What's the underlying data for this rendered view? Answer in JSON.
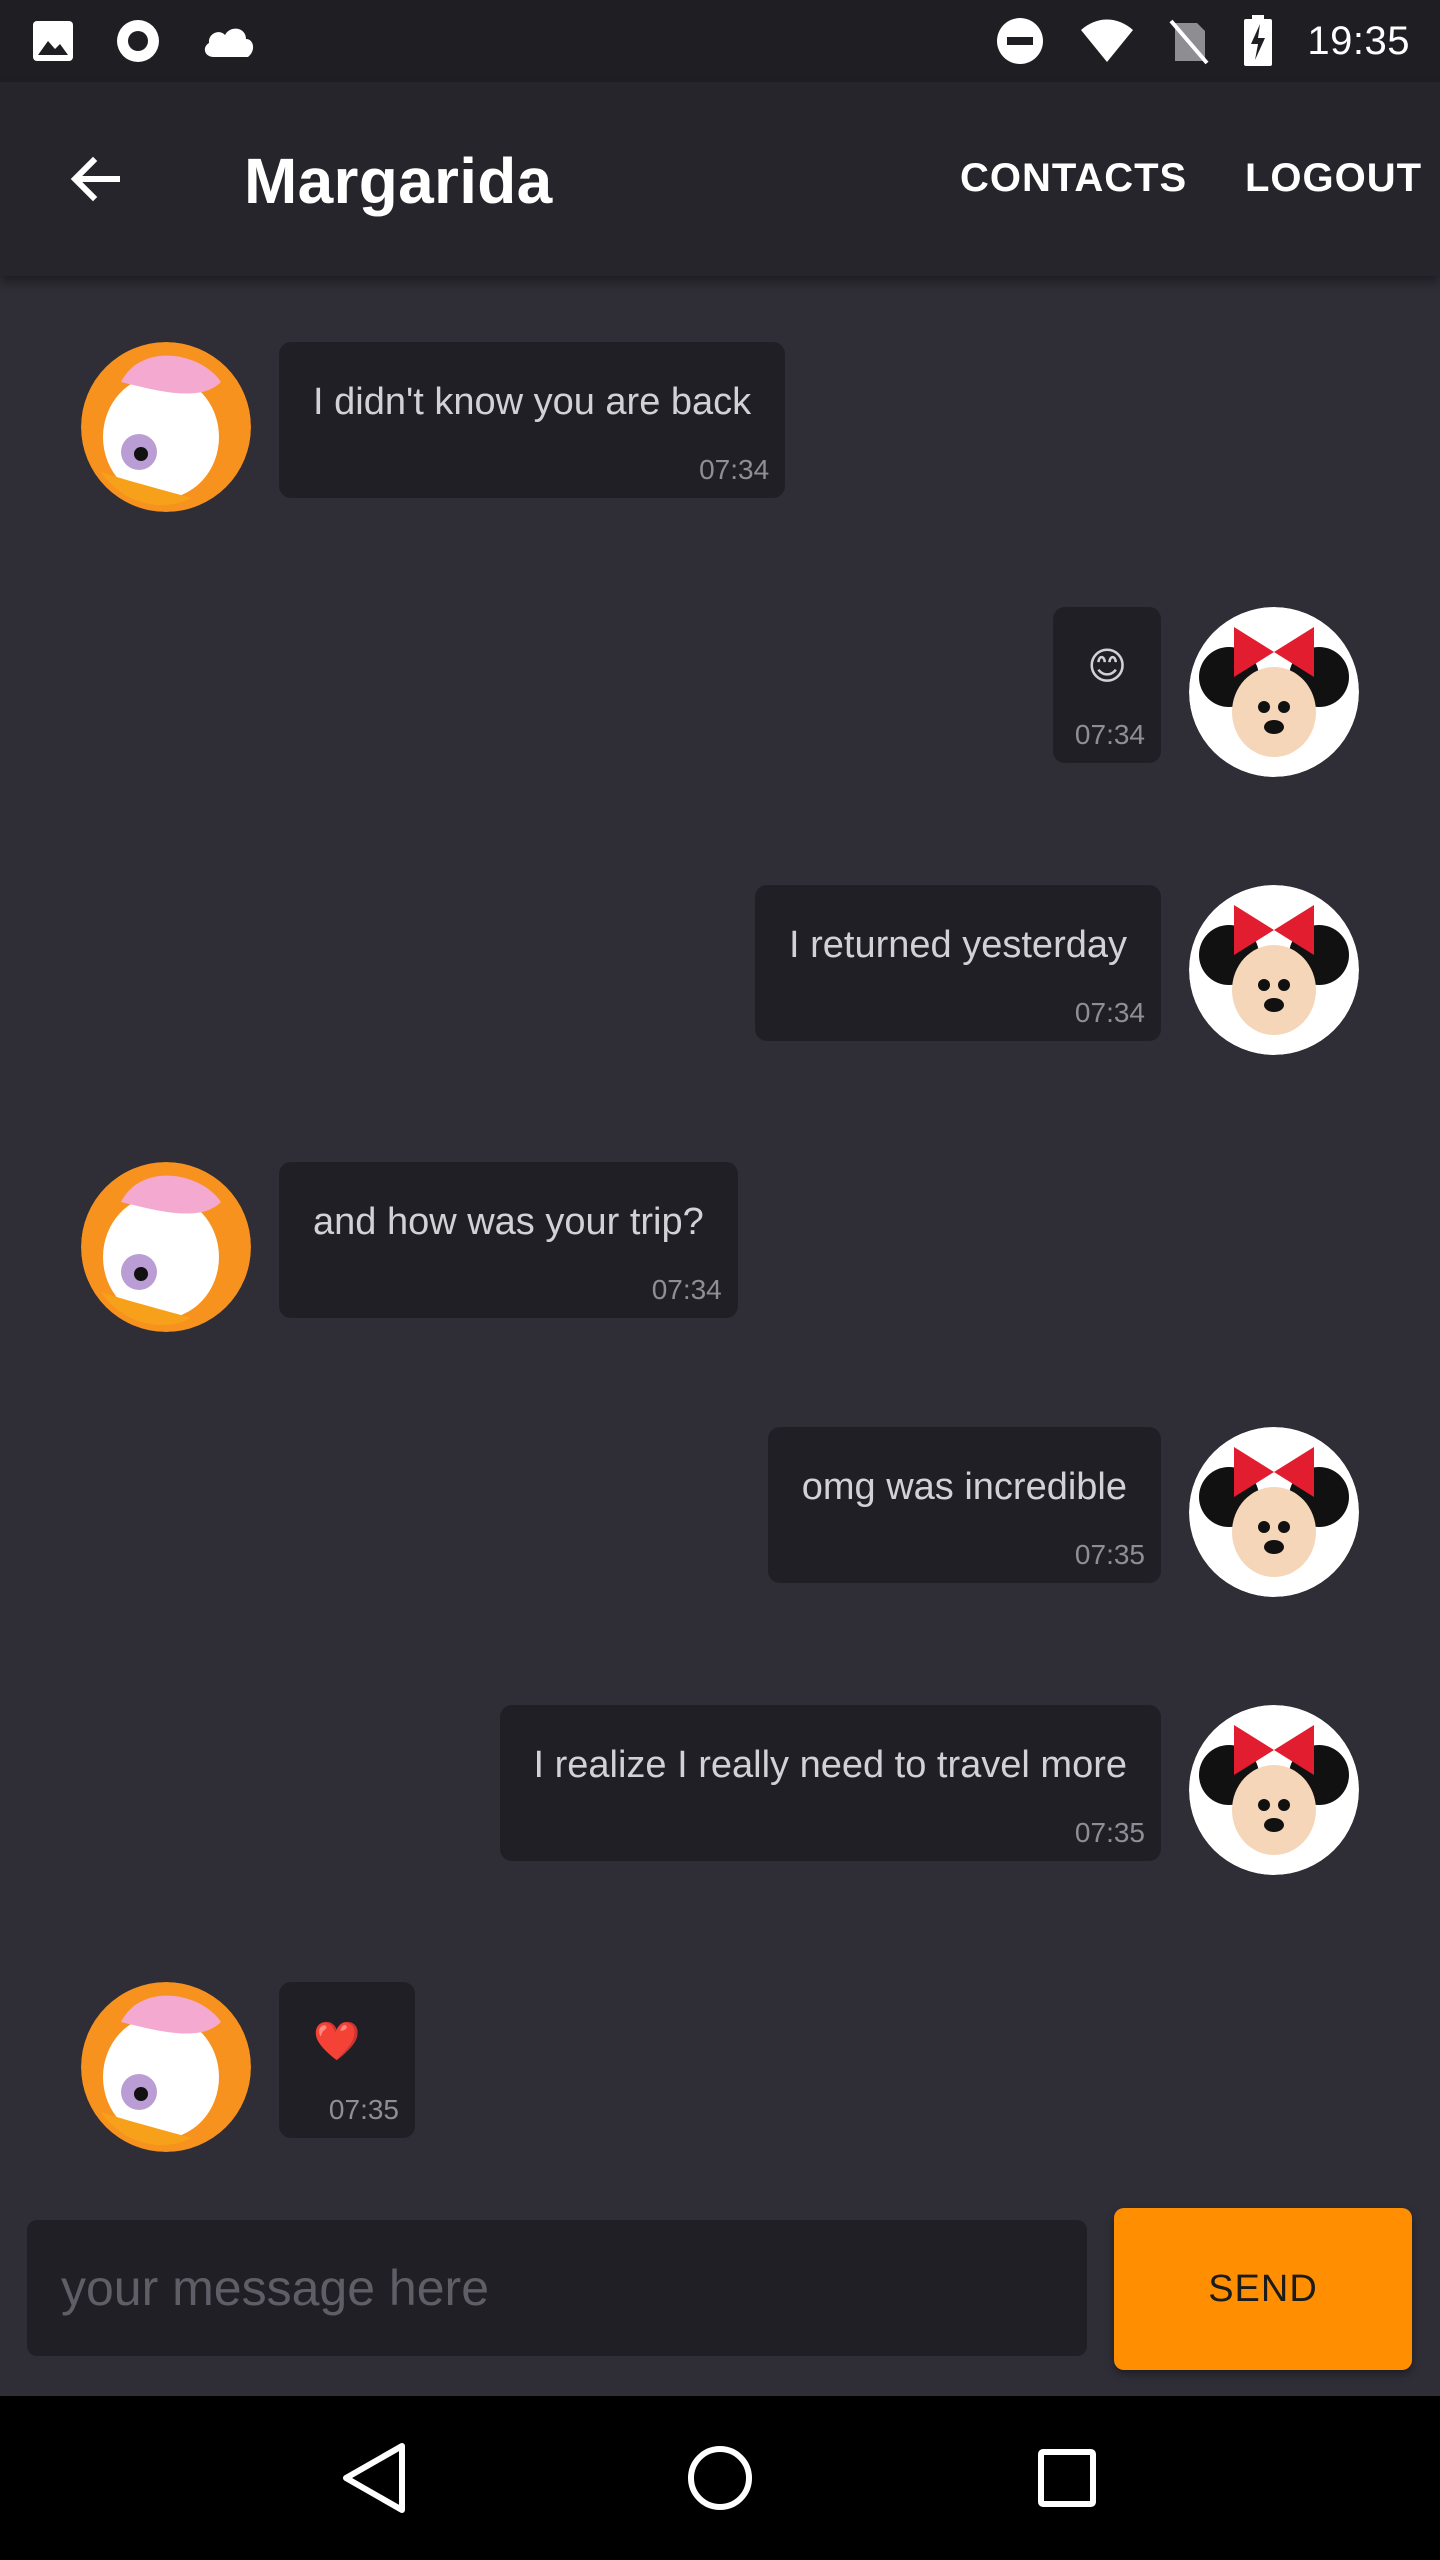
{
  "status_bar": {
    "time": "19:35",
    "left_icons": [
      "image-icon",
      "record-icon",
      "cloud-icon"
    ],
    "right_icons": [
      "do-not-disturb-icon",
      "wifi-icon",
      "no-sim-icon",
      "battery-charging-icon"
    ]
  },
  "app_bar": {
    "title": "Margarida",
    "actions": {
      "contacts": "CONTACTS",
      "logout": "LOGOUT"
    }
  },
  "messages": [
    {
      "direction": "in",
      "text": "I didn't know you are back",
      "time": "07:34",
      "avatar": "daisy-duck-avatar"
    },
    {
      "direction": "out",
      "text": "😊",
      "time": "07:34",
      "avatar": "minnie-mouse-avatar"
    },
    {
      "direction": "out",
      "text": "I returned yesterday",
      "time": "07:34",
      "avatar": "minnie-mouse-avatar"
    },
    {
      "direction": "in",
      "text": "and how was your trip?",
      "time": "07:34",
      "avatar": "daisy-duck-avatar"
    },
    {
      "direction": "out",
      "text": "omg was incredible",
      "time": "07:35",
      "avatar": "minnie-mouse-avatar"
    },
    {
      "direction": "out",
      "text": "I realize I really need to travel more",
      "time": "07:35",
      "avatar": "minnie-mouse-avatar"
    },
    {
      "direction": "in",
      "text": "❤️",
      "time": "07:35",
      "avatar": "daisy-duck-avatar"
    }
  ],
  "composer": {
    "placeholder": "your message here",
    "value": "",
    "send_label": "SEND"
  },
  "colors": {
    "background": "#2f2d36",
    "bubble": "#211f26",
    "app_bar": "#26252b",
    "accent": "#ff8f00"
  }
}
